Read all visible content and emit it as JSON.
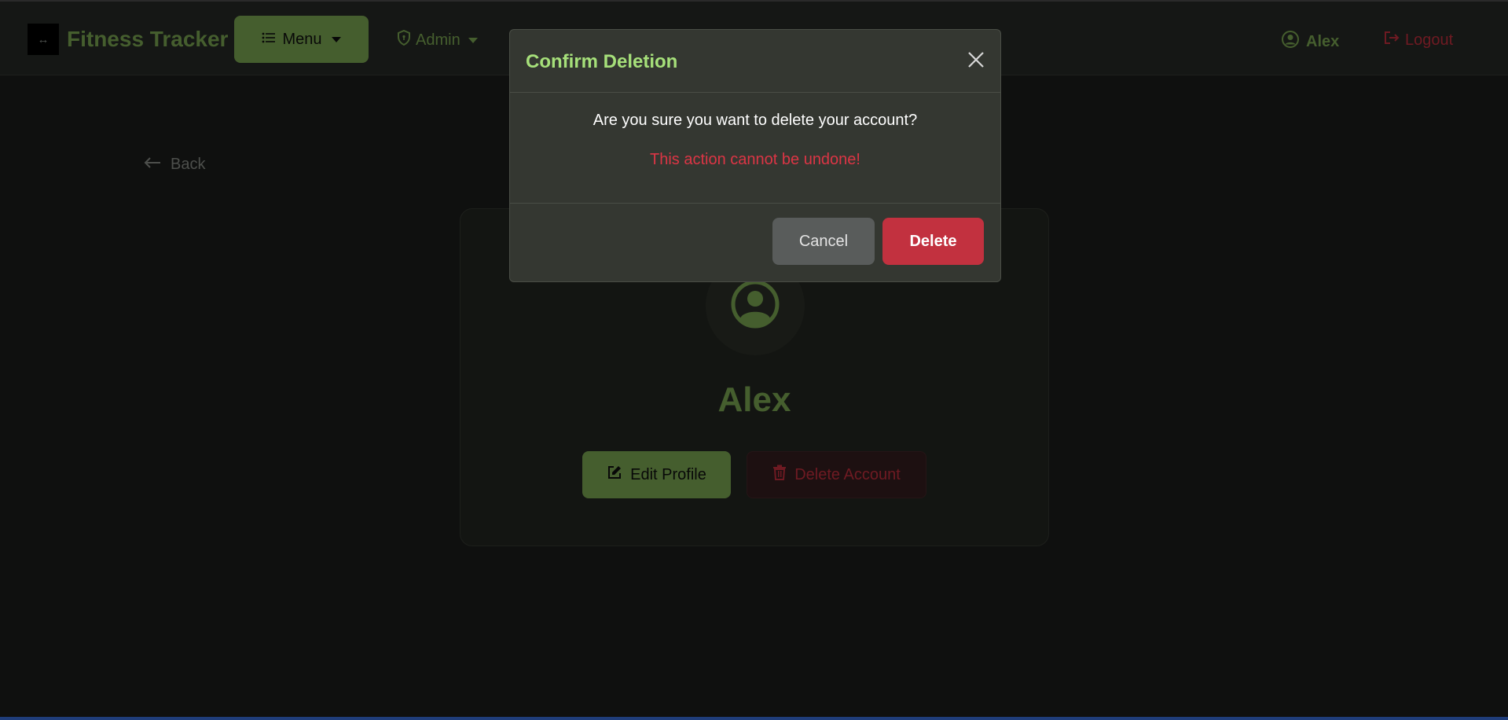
{
  "navbar": {
    "brand_icon": "↔",
    "brand_title": "Fitness Tracker",
    "menu_label": "Menu",
    "admin_label": "Admin",
    "user_label": "Alex",
    "logout_label": "Logout"
  },
  "page": {
    "back_label": "Back",
    "profile_name": "Alex",
    "edit_profile_label": "Edit Profile",
    "delete_account_label": "Delete Account"
  },
  "modal": {
    "title": "Confirm Deletion",
    "question": "Are you sure you want to delete your account?",
    "warning": "This action cannot be undone!",
    "cancel_label": "Cancel",
    "delete_label": "Delete"
  },
  "colors": {
    "accent_green": "#8bbd5c",
    "title_green": "#a6e07a",
    "danger_red": "#dc3545",
    "delete_button": "#c2313f",
    "cancel_button": "#595c5b"
  },
  "icons": {
    "brand": "dumbbell-icon",
    "menu": "list-icon",
    "admin": "shield-icon",
    "user": "user-circle-icon",
    "logout": "logout-icon",
    "back": "arrow-left-icon",
    "avatar": "user-circle-icon",
    "edit": "edit-icon",
    "delete": "trash-icon",
    "close": "close-icon"
  }
}
